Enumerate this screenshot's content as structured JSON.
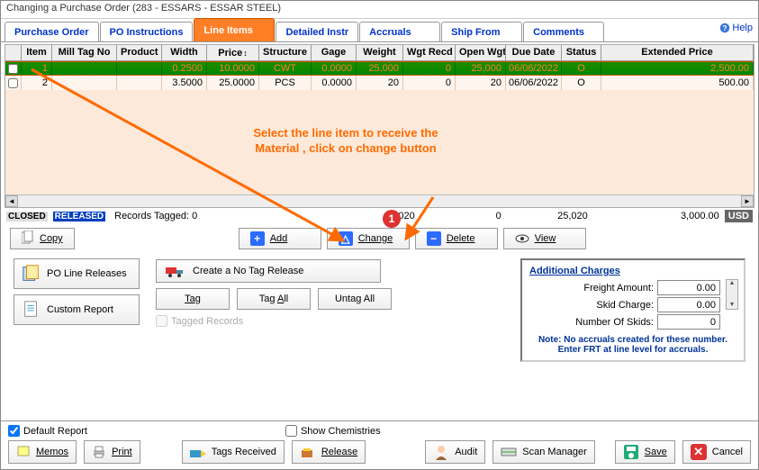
{
  "title": "Changing a Purchase Order  (283 - ESSARS -  ESSAR STEEL)",
  "tabs": [
    "Purchase Order",
    "PO Instructions",
    "Line Items",
    "Detailed Instr",
    "Accruals",
    "Ship From",
    "Comments"
  ],
  "active_tab": 2,
  "help": "Help",
  "columns": [
    "Item",
    "Mill Tag No",
    "Product",
    "Width",
    "Price",
    "Structure",
    "Gage",
    "Weight",
    "Wgt Recd",
    "Open Wgt",
    "Due Date",
    "Status",
    "Extended Price"
  ],
  "rows": [
    {
      "sel": true,
      "item": "1",
      "mill": "",
      "product": "",
      "width": "0.2500",
      "price": "10.0000",
      "struct": "CWT",
      "gage": "0.0000",
      "weight": "25,000",
      "wgt_recd": "0",
      "open": "25,000",
      "due": "06/06/2022",
      "status": "O",
      "ext": "2,500.00"
    },
    {
      "sel": false,
      "item": "2",
      "mill": "",
      "product": "",
      "width": "3.5000",
      "price": "25.0000",
      "struct": "PCS",
      "gage": "0.0000",
      "weight": "20",
      "wgt_recd": "0",
      "open": "20",
      "due": "06/06/2022",
      "status": "O",
      "ext": "500.00"
    }
  ],
  "status": {
    "closed": "CLOSED",
    "released": "RELEASED",
    "tagged": "Records Tagged:  0",
    "sum_weight": "25,020",
    "sum_recd": "0",
    "sum_open": "25,020",
    "sum_ext": "3,000.00",
    "currency": "USD"
  },
  "buttons": {
    "copy": "Copy",
    "add": "Add",
    "change": "Change",
    "delete": "Delete",
    "view": "View"
  },
  "left_btns": {
    "poline": "PO Line Releases",
    "custom": "Custom Report"
  },
  "notag": "Create a No Tag Release",
  "tag": "Tag",
  "tag_all": "Tag All",
  "untag": "Untag All",
  "tagged_records": "Tagged Records",
  "charges": {
    "title": "Additional Charges",
    "freight_l": "Freight Amount:",
    "freight": "0.00",
    "skid_l": "Skid Charge:",
    "skid": "0.00",
    "numskid_l": "Number Of Skids:",
    "numskid": "0",
    "note1": "Note: No accruals created for these number.",
    "note2": "Enter FRT at line level for accruals."
  },
  "footer": {
    "default": "Default Report",
    "showchem": "Show Chemistries",
    "memos": "Memos",
    "print": "Print",
    "tagsrec": "Tags Received",
    "release": "Release",
    "audit": "Audit",
    "scan": "Scan Manager",
    "save": "Save",
    "cancel": "Cancel"
  },
  "annot": "Select the line item to receive the Material , click on change button",
  "annot_num": "1"
}
